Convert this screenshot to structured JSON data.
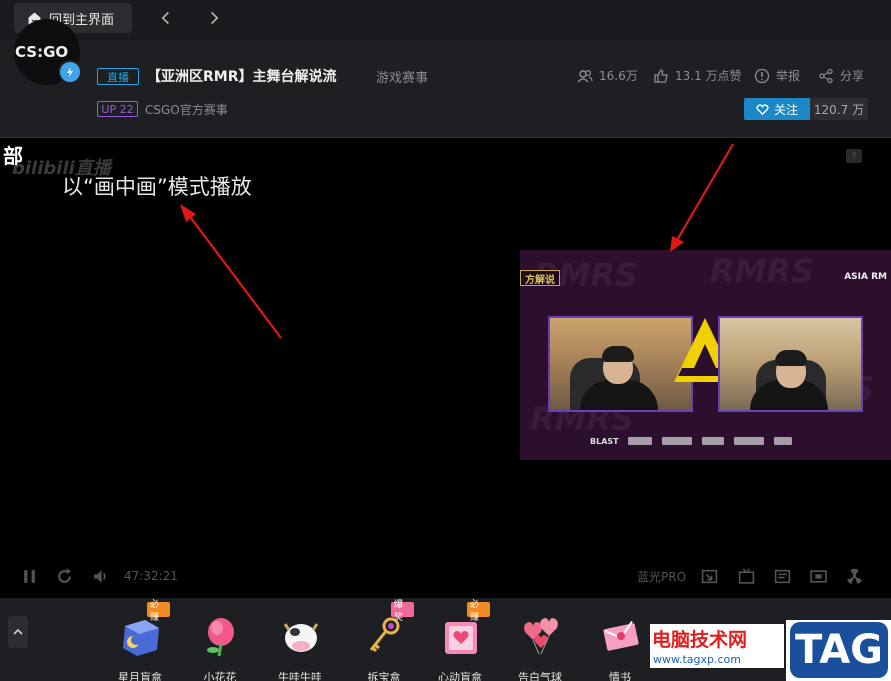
{
  "topbar": {
    "home_label": "回到主界面"
  },
  "header": {
    "live_tag": "直播",
    "title": "【亚洲区RMR】主舞台解说流",
    "category": "游戏赛事",
    "up_tag": "UP 22",
    "channel": "CSGO官方赛事",
    "avatar_text": "CS:GO",
    "stats": {
      "viewers": "16.6万",
      "likes": "13.1 万点赞",
      "report": "举报",
      "share": "分享"
    },
    "follow_label": "关注",
    "follow_count": "120.7 万"
  },
  "player": {
    "watermark": "bilibili直播",
    "corner_label": "部",
    "pip_note": "以“画中画”模式播放",
    "pip": {
      "caster_tag": "方解说",
      "event_label": "ASIA RM",
      "bg_text": "RMRS",
      "sponsor_blast": "BLAST"
    },
    "controls": {
      "time": "47:32:21",
      "quality": "蓝光PRO"
    }
  },
  "gifts": [
    {
      "name": "星月盲盒",
      "badge": "必赚",
      "badge_color": "#f08a24"
    },
    {
      "name": "小花花",
      "badge": "",
      "badge_color": ""
    },
    {
      "name": "牛哇牛哇",
      "badge": "",
      "badge_color": ""
    },
    {
      "name": "拆宝盒",
      "badge": "爆奖",
      "badge_color": "#f06a9a"
    },
    {
      "name": "心动盲盒",
      "badge": "必赚",
      "badge_color": "#f08a24"
    },
    {
      "name": "告白气球",
      "badge": "",
      "badge_color": ""
    },
    {
      "name": "情书",
      "badge": "",
      "badge_color": ""
    }
  ],
  "overlay": {
    "site_name": "电脑技术网",
    "site_url": "www.tagxp.com",
    "tag_logo": "TAG"
  },
  "colors": {
    "accent": "#1c88c8",
    "arrow": "#e01818",
    "live_tag": "#27a4e0",
    "up_tag": "#9a5ad8"
  }
}
